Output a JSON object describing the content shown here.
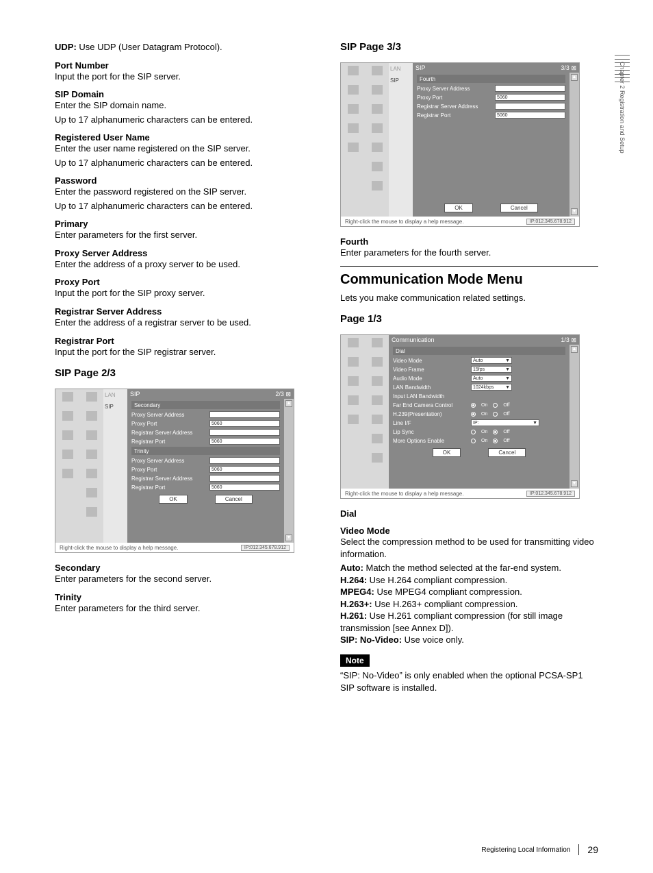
{
  "left": {
    "udp_label": "UDP:",
    "udp_desc": " Use UDP (User Datagram Protocol).",
    "port_number_h": "Port Number",
    "port_number_t": "Input the port for the SIP server.",
    "sip_domain_h": "SIP Domain",
    "sip_domain_t1": "Enter the SIP domain name.",
    "sip_domain_t2": "Up to 17 alphanumeric characters can be entered.",
    "reg_user_h": "Registered User Name",
    "reg_user_t1": "Enter the user name registered on the SIP server.",
    "reg_user_t2": "Up to 17 alphanumeric characters can be entered.",
    "password_h": "Password",
    "password_t1": "Enter the password registered on the SIP server.",
    "password_t2": "Up to 17 alphanumeric characters can be entered.",
    "primary_h": "Primary",
    "primary_t": "Enter parameters for the first server.",
    "proxy_addr_h": "Proxy Server Address",
    "proxy_addr_t": "Enter the address of a proxy server to be used.",
    "proxy_port_h": "Proxy Port",
    "proxy_port_t": "Input the port for the SIP proxy server.",
    "reg_srv_h": "Registrar Server Address",
    "reg_srv_t": "Enter the address of a registrar server to be used.",
    "reg_port_h": "Registrar Port",
    "reg_port_t": "Input the port for the SIP registrar server.",
    "sip23_h": "SIP Page 2/3",
    "secondary_h": "Secondary",
    "secondary_t": "Enter parameters for the second server.",
    "trinity_h": "Trinity",
    "trinity_t": "Enter parameters for the third server."
  },
  "right": {
    "sip33_h": "SIP Page 3/3",
    "fourth_h": "Fourth",
    "fourth_t": "Enter parameters for the fourth server.",
    "comm_menu_h": "Communication Mode Menu",
    "comm_menu_t": "Lets you make communication related settings.",
    "page13_h": "Page 1/3",
    "dial_h": "Dial",
    "vmode_h": "Video Mode",
    "vmode_t1": "Select the compression method to be used for transmitting video information.",
    "vm_auto_l": "Auto:",
    "vm_auto_t": " Match the method selected at the far-end system.",
    "vm_h264_l": "H.264:",
    "vm_h264_t": " Use H.264 compliant compression.",
    "vm_mpeg4_l": "MPEG4:",
    "vm_mpeg4_t": " Use MPEG4 compliant compression.",
    "vm_h263p_l": "H.263+:",
    "vm_h263p_t": " Use H.263+ compliant compression.",
    "vm_h261_l": "H.261:",
    "vm_h261_t": " Use H.261 compliant compression (for still image transmission [see Annex D]).",
    "vm_sip_l": "SIP: No-Video:",
    "vm_sip_t": " Use voice only.",
    "note_h": "Note",
    "note_t": "“SIP: No-Video” is only enabled when the optional PCSA-SP1 SIP software is installed."
  },
  "scr2": {
    "tab1": "LAN",
    "tab2": "SIP",
    "title": "SIP",
    "pager": "2/3",
    "sub_secondary": "Secondary",
    "sub_trinity": "Trinity",
    "r_proxy_addr": "Proxy Server Address",
    "r_proxy_port": "Proxy Port",
    "v_proxy_port": "5060",
    "r_reg_addr": "Registrar Server Address",
    "r_reg_port": "Registrar Port",
    "v_reg_port": "5060",
    "btn_ok": "OK",
    "btn_cancel": "Cancel",
    "help": "Right-click the mouse to display a help message.",
    "ip": "IP:012.345.678.912"
  },
  "scr3": {
    "tab1": "LAN",
    "tab2": "SIP",
    "title": "SIP",
    "pager": "3/3",
    "sub_fourth": "Fourth",
    "r_proxy_addr": "Proxy Server Address",
    "r_proxy_port": "Proxy Port",
    "v_proxy_port": "5060",
    "r_reg_addr": "Registrar Server Address",
    "r_reg_port": "Registrar Port",
    "v_reg_port": "5060",
    "btn_ok": "OK",
    "btn_cancel": "Cancel",
    "help": "Right-click the mouse to display a help message.",
    "ip": "IP:012.345.678.912"
  },
  "scr_comm": {
    "title": "Communication",
    "pager": "1/3",
    "sub_dial": "Dial",
    "r_video_mode": "Video Mode",
    "v_video_mode": "Auto",
    "r_video_frame": "Video Frame",
    "v_video_frame": "15fps",
    "r_audio_mode": "Audio Mode",
    "v_audio_mode": "Auto",
    "r_lan_bw": "LAN Bandwidth",
    "v_lan_bw": "1024kbps",
    "r_in_lan_bw": "Input LAN Bandwidth",
    "r_fecc": "Far End Camera Control",
    "r_h239": "H.239(Presentation)",
    "r_line": "Line I/F",
    "v_line": "IP:",
    "r_lip": "Lip Sync",
    "r_more": "More Options Enable",
    "on": "On",
    "off": "Off",
    "btn_ok": "OK",
    "btn_cancel": "Cancel",
    "help": "Right-click the mouse to display a help message.",
    "ip": "IP:012.345.678.912"
  },
  "side_tab": "Chapter 2  Registration and Setup",
  "footer": {
    "text": "Registering Local Information",
    "page": "29"
  }
}
